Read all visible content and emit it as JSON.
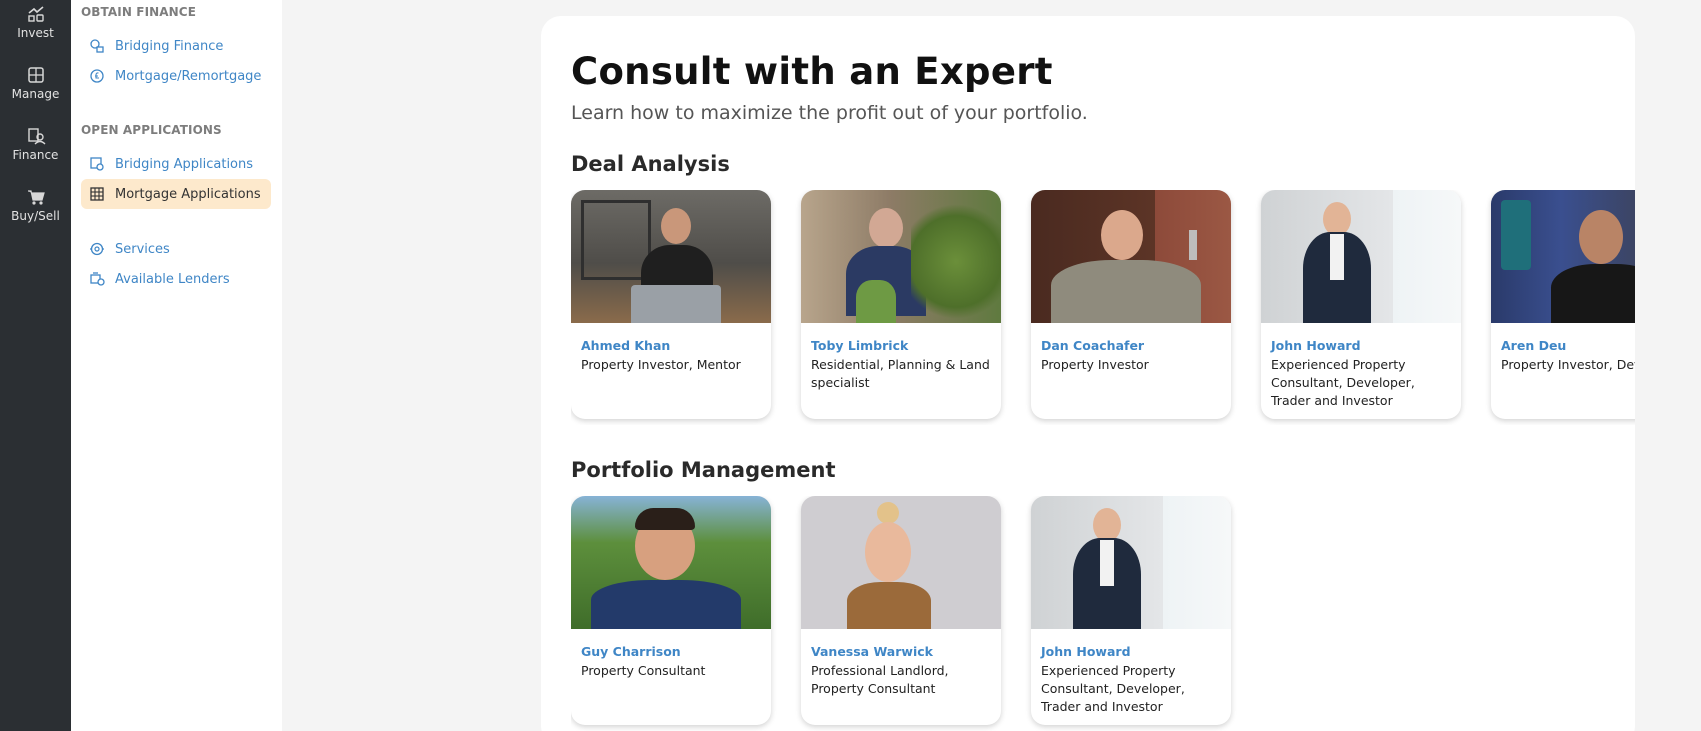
{
  "rail": {
    "items": [
      {
        "label": "Invest",
        "icon": "invest-icon"
      },
      {
        "label": "Manage",
        "icon": "manage-icon"
      },
      {
        "label": "Finance",
        "icon": "finance-icon"
      },
      {
        "label": "Buy/Sell",
        "icon": "cart-icon"
      }
    ]
  },
  "sidebar": {
    "obtain_title": "OBTAIN FINANCE",
    "obtain_items": [
      {
        "label": "Bridging Finance",
        "icon": "bridging-finance-icon"
      },
      {
        "label": "Mortgage/Remortgage",
        "icon": "mortgage-icon"
      }
    ],
    "open_title": "OPEN APPLICATIONS",
    "open_items": [
      {
        "label": "Bridging Applications",
        "icon": "bridging-applications-icon"
      },
      {
        "label": "Mortgage Applications",
        "icon": "table-icon"
      }
    ],
    "other_items": [
      {
        "label": "Services",
        "icon": "services-icon"
      },
      {
        "label": "Available Lenders",
        "icon": "lenders-icon"
      }
    ]
  },
  "main": {
    "title": "Consult with an Expert",
    "subtitle": "Learn how to maximize the profit out of your portfolio.",
    "sections": [
      {
        "heading": "Deal Analysis",
        "experts": [
          {
            "name": "Ahmed Khan",
            "role": "Property Investor, Mentor"
          },
          {
            "name": "Toby Limbrick",
            "role": "Residential, Planning & Land specialist"
          },
          {
            "name": "Dan Coachafer",
            "role": "Property Investor"
          },
          {
            "name": "John Howard",
            "role": "Experienced Property Consultant, Developer, Trader and Investor"
          },
          {
            "name": "Aren Deu",
            "role": "Property Investor, Developer"
          }
        ]
      },
      {
        "heading": "Portfolio Management",
        "experts": [
          {
            "name": "Guy Charrison",
            "role": "Property Consultant"
          },
          {
            "name": "Vanessa Warwick",
            "role": "Professional Landlord, Property Consultant"
          },
          {
            "name": "John Howard",
            "role": "Experienced Property Consultant, Developer, Trader and Investor"
          }
        ]
      }
    ]
  },
  "colors": {
    "rail_bg": "#2b2f33",
    "link_blue": "#3f86c6",
    "active_bg": "#fde9cc",
    "page_bg": "#f4f4f4"
  }
}
